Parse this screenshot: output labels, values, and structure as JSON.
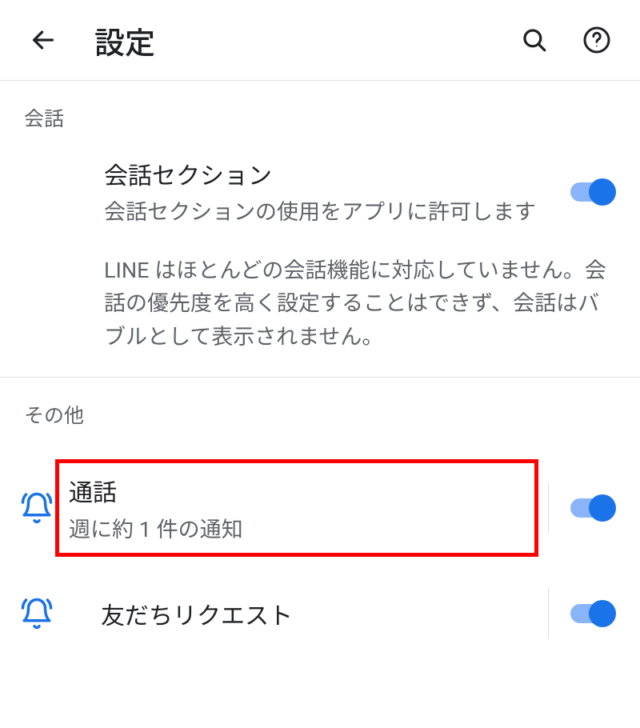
{
  "header": {
    "title": "設定"
  },
  "sections": {
    "conversation": {
      "label": "会話",
      "section_setting": {
        "title": "会話セクション",
        "desc": "会話セクションの使用をアプリに許可します",
        "enabled": true
      },
      "info": "LINE はほとんどの会話機能に対応していません。会話の優先度を高く設定することはできず、会話はバブルとして表示されません。"
    },
    "other": {
      "label": "その他",
      "channels": [
        {
          "title": "通話",
          "sub": "週に約 1 件の通知",
          "enabled": true
        },
        {
          "title": "友だちリクエスト",
          "sub": "",
          "enabled": true
        }
      ]
    }
  }
}
